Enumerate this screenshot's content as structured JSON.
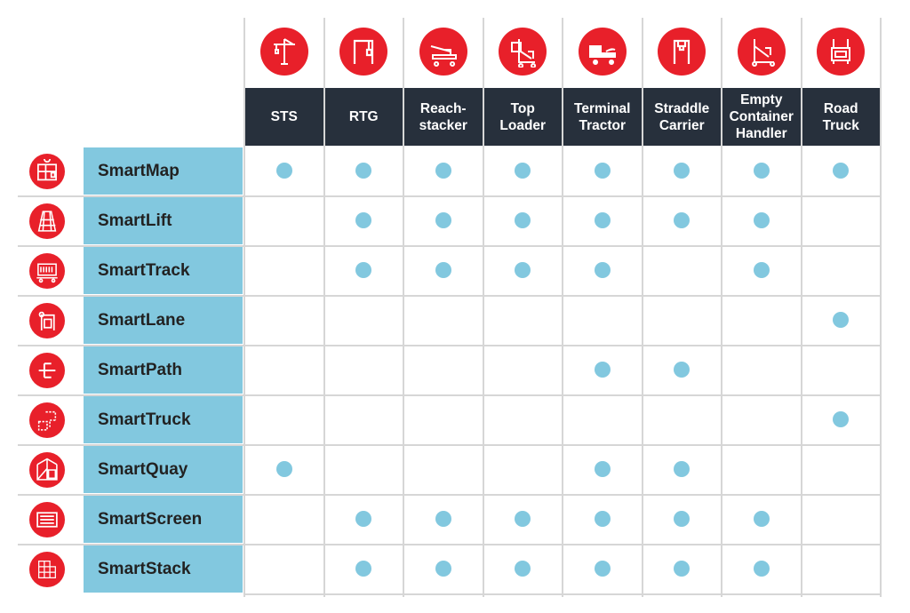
{
  "columns": [
    {
      "label": "STS",
      "icon": "sts-crane-icon"
    },
    {
      "label": "RTG",
      "icon": "rtg-crane-icon"
    },
    {
      "label": "Reach-\nstacker",
      "icon": "reach-stacker-icon"
    },
    {
      "label": "Top\nLoader",
      "icon": "top-loader-icon"
    },
    {
      "label": "Terminal\nTractor",
      "icon": "terminal-tractor-icon"
    },
    {
      "label": "Straddle\nCarrier",
      "icon": "straddle-carrier-icon"
    },
    {
      "label": "Empty\nContainer\nHandler",
      "icon": "empty-container-handler-icon"
    },
    {
      "label": "Road\nTruck",
      "icon": "road-truck-icon"
    }
  ],
  "rows": [
    {
      "label": "SmartMap",
      "icon": "smartmap-icon",
      "support": [
        1,
        1,
        1,
        1,
        1,
        1,
        1,
        1
      ]
    },
    {
      "label": "SmartLift",
      "icon": "smartlift-icon",
      "support": [
        0,
        1,
        1,
        1,
        1,
        1,
        1,
        0
      ]
    },
    {
      "label": "SmartTrack",
      "icon": "smarttrack-icon",
      "support": [
        0,
        1,
        1,
        1,
        1,
        0,
        1,
        0
      ]
    },
    {
      "label": "SmartLane",
      "icon": "smartlane-icon",
      "support": [
        0,
        0,
        0,
        0,
        0,
        0,
        0,
        1
      ]
    },
    {
      "label": "SmartPath",
      "icon": "smartpath-icon",
      "support": [
        0,
        0,
        0,
        0,
        1,
        1,
        0,
        0
      ]
    },
    {
      "label": "SmartTruck",
      "icon": "smarttruck-icon",
      "support": [
        0,
        0,
        0,
        0,
        0,
        0,
        0,
        1
      ]
    },
    {
      "label": "SmartQuay",
      "icon": "smartquay-icon",
      "support": [
        1,
        0,
        0,
        0,
        1,
        1,
        0,
        0
      ]
    },
    {
      "label": "SmartScreen",
      "icon": "smartscreen-icon",
      "support": [
        0,
        1,
        1,
        1,
        1,
        1,
        1,
        0
      ]
    },
    {
      "label": "SmartStack",
      "icon": "smartstack-icon",
      "support": [
        0,
        1,
        1,
        1,
        1,
        1,
        1,
        0
      ]
    }
  ],
  "colors": {
    "accent_red": "#e8202a",
    "header_dark": "#27303c",
    "row_blue": "#82c8df",
    "grid": "#d6d6d6"
  }
}
